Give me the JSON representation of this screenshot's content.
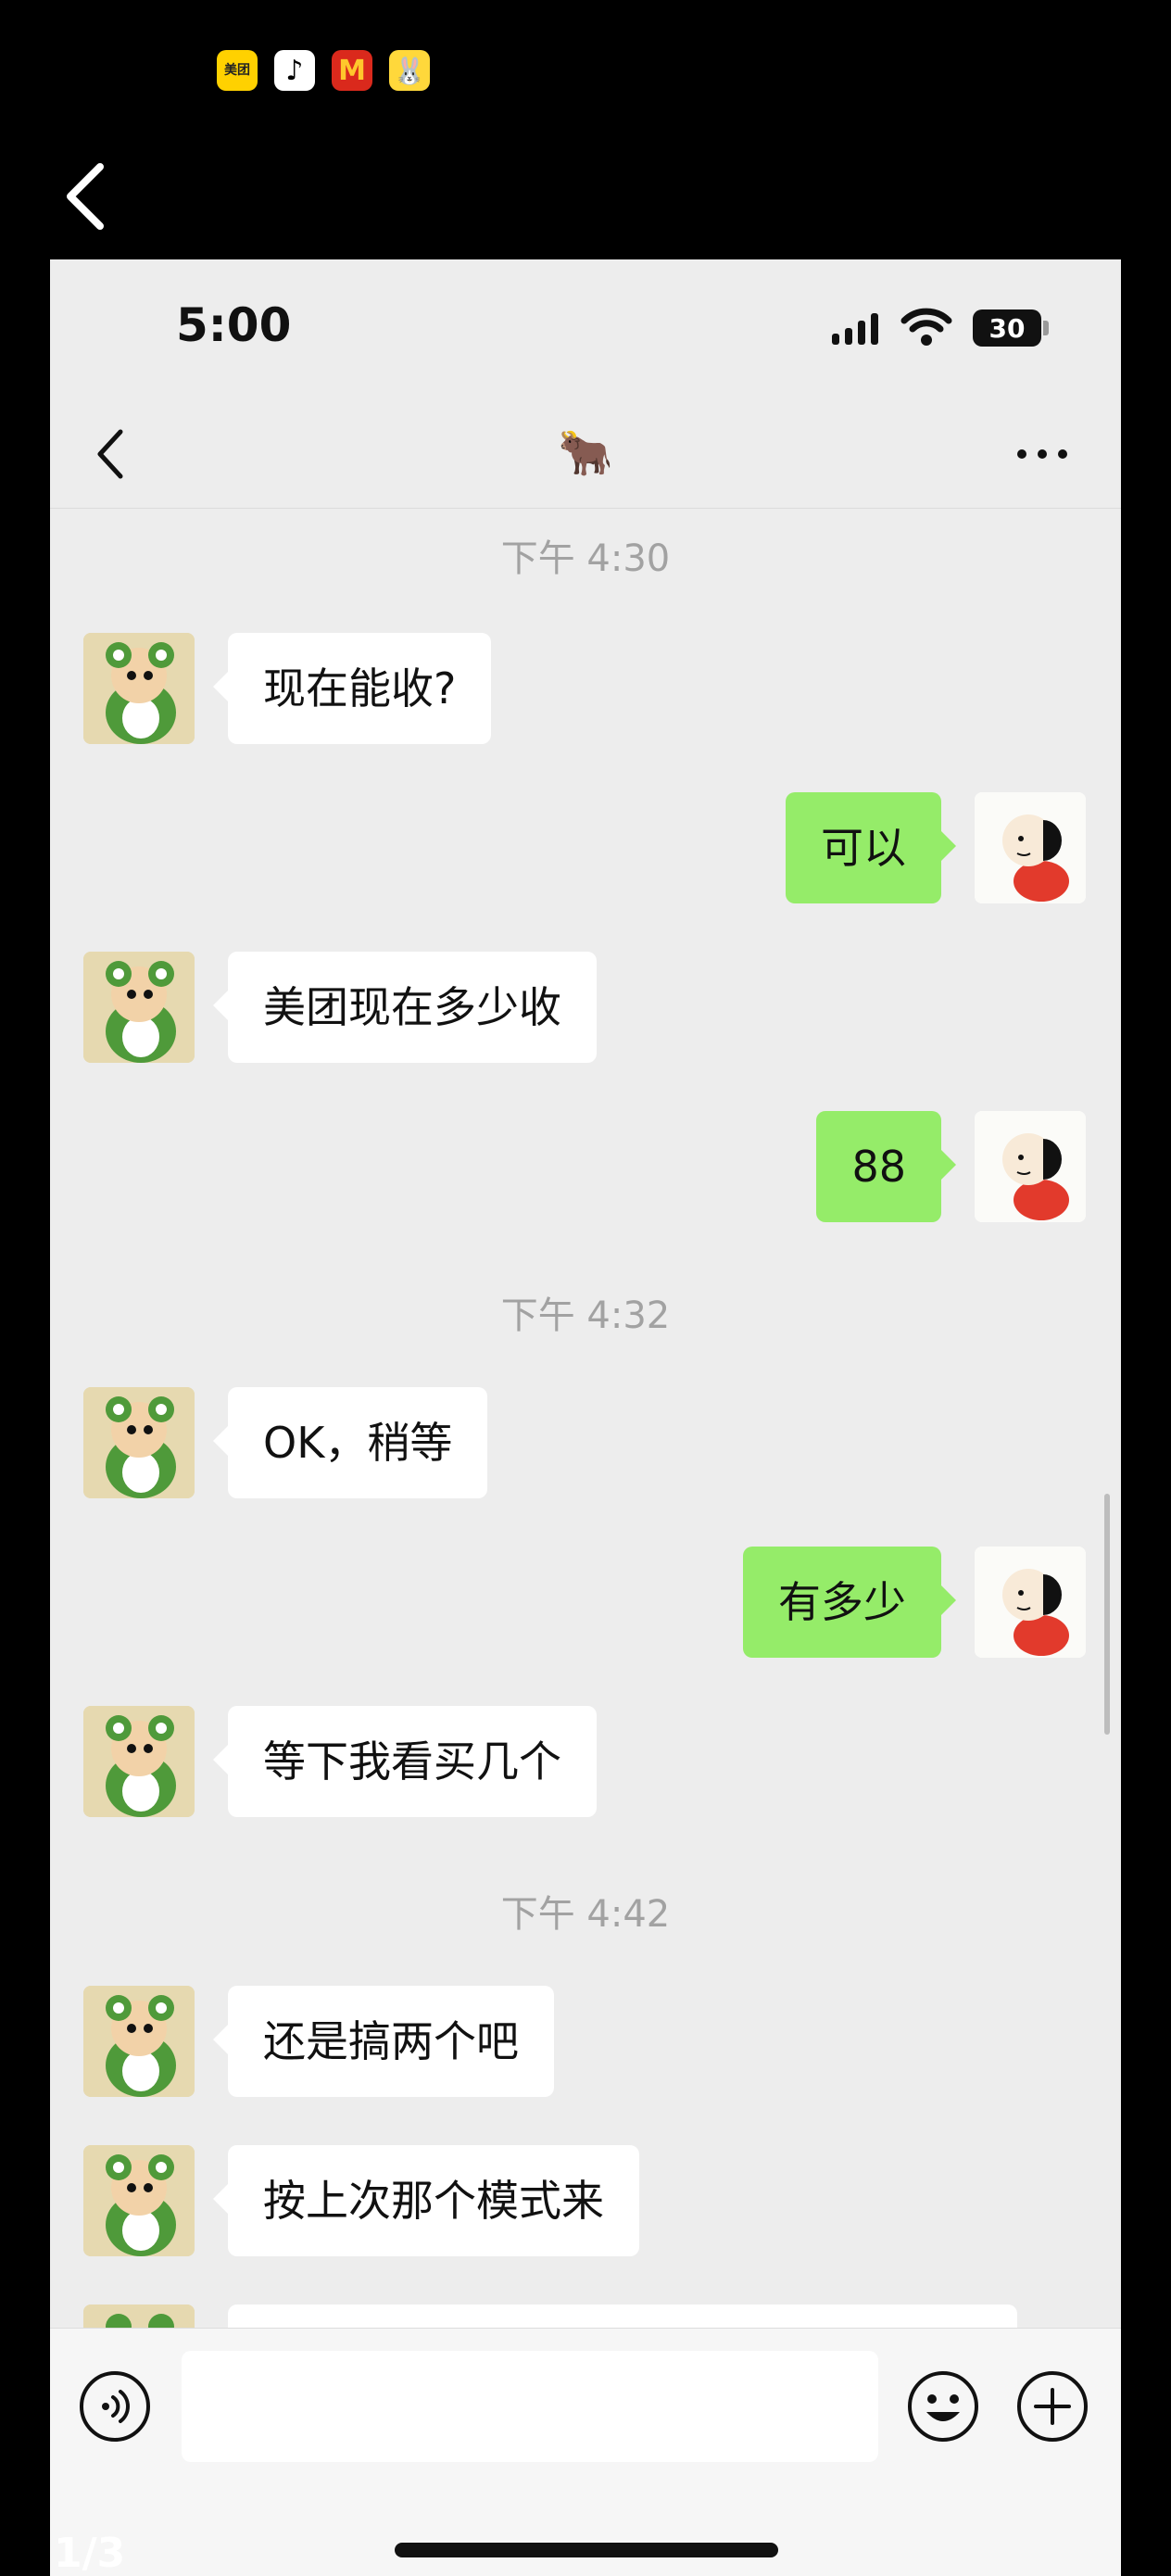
{
  "viewer": {
    "app_icons": [
      {
        "name": "meituan-app-icon",
        "label": "美团"
      },
      {
        "name": "douyin-app-icon",
        "label": "♪"
      },
      {
        "name": "mcdonalds-app-icon",
        "label": "M"
      },
      {
        "name": "rabbit-app-icon",
        "label": "🐰"
      }
    ],
    "page_counter": "1/3"
  },
  "status_bar": {
    "time": "5:00",
    "battery": "30"
  },
  "header": {
    "title": "🐂",
    "back_icon": "chevron-left-icon",
    "more_icon": "more-dots-icon"
  },
  "messages": [
    {
      "type": "time",
      "text": "下午 4:30"
    },
    {
      "type": "in",
      "text": "现在能收?"
    },
    {
      "type": "out",
      "text": "可以"
    },
    {
      "type": "in",
      "text": "美团现在多少收"
    },
    {
      "type": "out",
      "text": "88"
    },
    {
      "type": "time",
      "text": "下午 4:32"
    },
    {
      "type": "in",
      "text": "OK，稍等"
    },
    {
      "type": "out",
      "text": "有多少"
    },
    {
      "type": "in",
      "text": "等下我看买几个"
    },
    {
      "type": "time",
      "text": "下午 4:42"
    },
    {
      "type": "in",
      "text": "还是搞两个吧"
    },
    {
      "type": "in",
      "text": "按上次那个模式来"
    }
  ],
  "input_bar": {
    "voice_icon": "voice-icon",
    "emoji_icon": "emoji-icon",
    "plus_icon": "plus-icon",
    "input_value": ""
  },
  "colors": {
    "incoming_bubble": "#ffffff",
    "outgoing_bubble": "#95ec69",
    "chat_background": "#ededed"
  }
}
